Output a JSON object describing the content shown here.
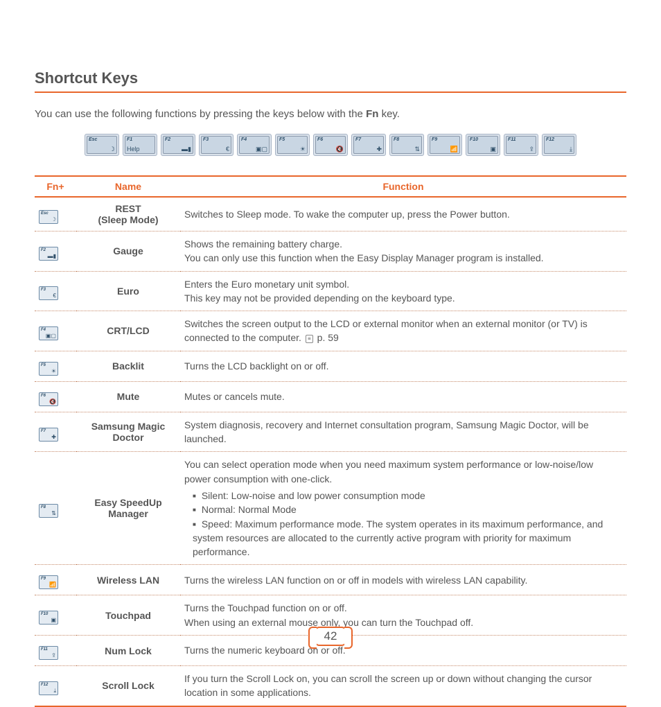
{
  "title": "Shortcut Keys",
  "intro_pre": "You can use the following functions by pressing the keys below with the ",
  "intro_bold": "Fn",
  "intro_post": " key.",
  "topkeys": [
    {
      "label": "Esc",
      "icon": "☽"
    },
    {
      "label": "F1",
      "icon": "Help",
      "help": true
    },
    {
      "label": "F2",
      "icon": "▬▮"
    },
    {
      "label": "F3",
      "icon": "€"
    },
    {
      "label": "F4",
      "icon": "▣▢"
    },
    {
      "label": "F5",
      "icon": "☀"
    },
    {
      "label": "F6",
      "icon": "🔇"
    },
    {
      "label": "F7",
      "icon": "✚"
    },
    {
      "label": "F8",
      "icon": "⇅"
    },
    {
      "label": "F9",
      "icon": "📶"
    },
    {
      "label": "F10",
      "icon": "▣"
    },
    {
      "label": "F11",
      "icon": "⇪"
    },
    {
      "label": "F12",
      "icon": "⤓"
    }
  ],
  "table": {
    "headers": {
      "fn": "Fn+",
      "name": "Name",
      "func": "Function"
    },
    "rows": [
      {
        "key": {
          "label": "Esc",
          "icon": "☽"
        },
        "name": "REST\n(Sleep Mode)",
        "func": "Switches to Sleep mode. To wake the computer up, press the Power button."
      },
      {
        "key": {
          "label": "F2",
          "icon": "▬▮"
        },
        "name": "Gauge",
        "func": "Shows the remaining battery charge.\nYou can only use this function when the Easy Display Manager program is installed."
      },
      {
        "key": {
          "label": "F3",
          "icon": "€"
        },
        "name": "Euro",
        "func": "Enters the Euro monetary unit symbol.\nThis key may not be provided depending on the keyboard type."
      },
      {
        "key": {
          "label": "F4",
          "icon": "▣▢"
        },
        "name": "CRT/LCD",
        "func_crt_pre": "Switches the screen output to the LCD or external monitor when an external monitor (or TV) is connected to the computer. ",
        "func_crt_post": " p. 59"
      },
      {
        "key": {
          "label": "F5",
          "icon": "☀"
        },
        "name": "Backlit",
        "func": "Turns the LCD backlight on or off."
      },
      {
        "key": {
          "label": "F6",
          "icon": "🔇"
        },
        "name": "Mute",
        "func": "Mutes or cancels mute."
      },
      {
        "key": {
          "label": "F7",
          "icon": "✚"
        },
        "name": "Samsung Magic Doctor",
        "func": "System diagnosis, recovery and Internet consultation program, Samsung Magic Doctor, will be launched."
      },
      {
        "key": {
          "label": "F8",
          "icon": "⇅"
        },
        "name": "Easy SpeedUp Manager",
        "func_speed_intro": "You can select operation mode when you need maximum system performance or low-noise/low power consumption with one-click.",
        "modes": [
          "Silent: Low-noise and low power consumption mode",
          "Normal: Normal Mode",
          "Speed: Maximum performance mode. The system operates in its maximum performance, and system resources are allocated to the currently active program with priority for maximum performance."
        ]
      },
      {
        "key": {
          "label": "F9",
          "icon": "📶"
        },
        "name": "Wireless LAN",
        "func": "Turns the wireless LAN function on or off in models with wireless LAN capability."
      },
      {
        "key": {
          "label": "F10",
          "icon": "▣"
        },
        "name": "Touchpad",
        "func": "Turns the Touchpad function on or off.\nWhen using an external mouse only, you can turn the Touchpad off."
      },
      {
        "key": {
          "label": "F11",
          "icon": "⇪"
        },
        "name": "Num Lock",
        "func": "Turns the numeric keyboard on or off."
      },
      {
        "key": {
          "label": "F12",
          "icon": "⤓"
        },
        "name": "Scroll Lock",
        "func": "If you turn the Scroll Lock on, you can scroll the screen up or down without changing the cursor location in some applications."
      }
    ]
  },
  "page": "42"
}
